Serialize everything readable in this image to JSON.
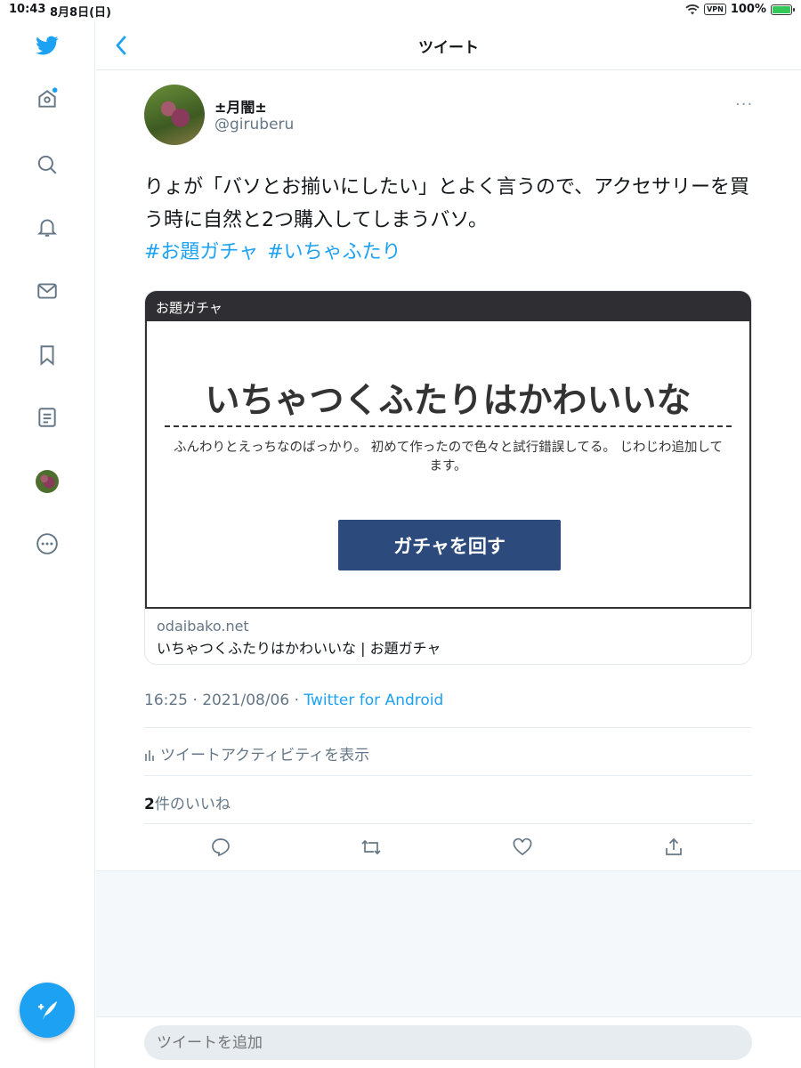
{
  "status_bar": {
    "time": "10:43",
    "date": "8月8日(日)",
    "vpn": "VPN",
    "battery": "100%"
  },
  "header": {
    "title": "ツイート"
  },
  "sidebar": {
    "items": [
      {
        "icon": "twitter-bird-icon"
      },
      {
        "icon": "home-icon"
      },
      {
        "icon": "search-icon"
      },
      {
        "icon": "notifications-icon"
      },
      {
        "icon": "messages-icon"
      },
      {
        "icon": "bookmark-icon"
      },
      {
        "icon": "lists-icon"
      },
      {
        "icon": "profile-avatar"
      },
      {
        "icon": "more-icon"
      }
    ],
    "compose_icon": "compose-tweet-icon"
  },
  "tweet": {
    "display_name": "±月闇±",
    "handle": "@giruberu",
    "more": "···",
    "text": "りょが「バソとお揃いにしたい」とよく言うので、アクセサリーを買う時に自然と2つ購入してしまうバソ。",
    "hashtags": [
      "#お題ガチャ",
      "#いちゃふたり"
    ],
    "card": {
      "banner": "お題ガチャ",
      "heading": "いちゃつくふたりはかわいいな",
      "description": "ふんわりとえっちなのばっかり。 初めて作ったので色々と試行錯誤してる。 じわじわ追加してます。",
      "button": "ガチャを回す",
      "domain": "odaibako.net",
      "title": "いちゃつくふたりはかわいいな | お題ガチャ"
    },
    "timestamp": "16:25 · 2021/08/06 · ",
    "source": "Twitter for Android",
    "activity": "ツイートアクティビティを表示",
    "likes_count": "2",
    "likes_label": "件のいいね"
  },
  "reply": {
    "placeholder": "ツイートを追加"
  },
  "colors": {
    "accent": "#1da1f2",
    "card_button": "#2d4a7d",
    "card_banner": "#2f2f33"
  }
}
